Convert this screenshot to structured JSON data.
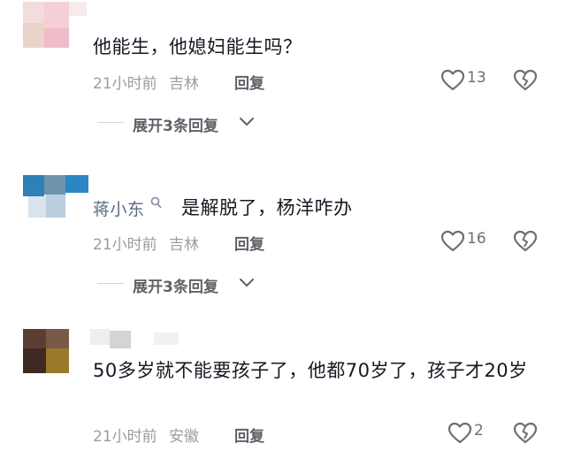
{
  "comments": [
    {
      "username": "",
      "text": "他能生，他媳妇能生吗？",
      "time": "21小时前",
      "location": "吉林",
      "reply_label": "回复",
      "likes": "13",
      "expand_label": "展开3条回复"
    },
    {
      "username": "蒋小东",
      "text": "是解脱了，杨洋咋办",
      "time": "21小时前",
      "location": "吉林",
      "reply_label": "回复",
      "likes": "16",
      "expand_label": "展开3条回复"
    },
    {
      "username": "",
      "text": "50多岁就不能要孩子了，他都70岁了，孩子才20岁",
      "time": "21小时前",
      "location": "安徽",
      "reply_label": "回复",
      "likes": "2"
    }
  ],
  "icons": {
    "like": "heart-outline-icon",
    "dislike": "broken-heart-icon",
    "expand": "chevron-down-icon",
    "search": "search-icon"
  },
  "colors": {
    "text": "#161823",
    "username": "#5d6b85",
    "meta": "#9a9ca3",
    "accent_gray": "#5f6168"
  }
}
